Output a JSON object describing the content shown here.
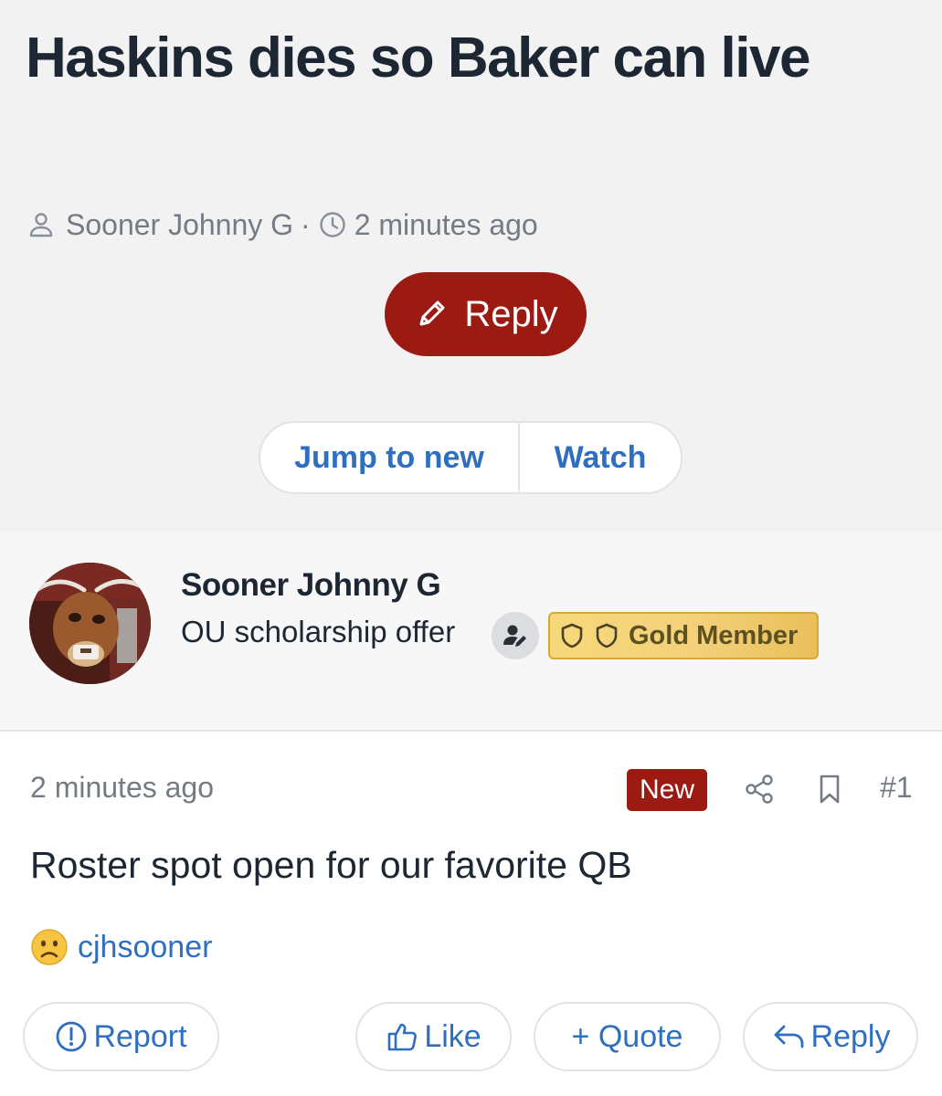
{
  "thread": {
    "title": "Haskins dies so Baker can live",
    "author": "Sooner Johnny G",
    "separator": "·",
    "time": "2 minutes ago",
    "reply_label": "Reply",
    "jump_label": "Jump to new",
    "watch_label": "Watch"
  },
  "author_card": {
    "name": "Sooner Johnny G",
    "role": "OU scholarship offer",
    "badge": "Gold Member",
    "badge_colors": {
      "fill": "#f4d07a",
      "border": "#d8a834",
      "text": "#5d5122"
    }
  },
  "post": {
    "time": "2 minutes ago",
    "new_label": "New",
    "number": "#1",
    "body": "Roster spot open for our favorite QB",
    "reaction": {
      "emoji": "frowning-face",
      "user": "cjhsooner"
    },
    "actions": {
      "report": "Report",
      "like": "Like",
      "quote": "+ Quote",
      "reply": "Reply"
    }
  },
  "colors": {
    "accent_red": "#9b1a12",
    "link_blue": "#2f6fbf",
    "header_bg": "#f2f2f3",
    "muted_text": "#757b84"
  },
  "icons": [
    "user-icon",
    "clock-icon",
    "pencil-icon",
    "user-edit-icon",
    "shield-icon",
    "share-icon",
    "bookmark-icon",
    "exclamation-circle-icon",
    "thumbs-up-icon",
    "reply-arrow-icon",
    "frowning-face-icon"
  ]
}
